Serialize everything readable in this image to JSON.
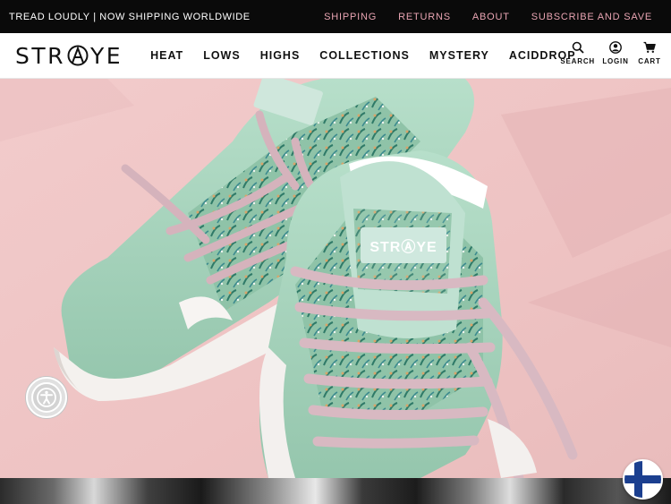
{
  "announcement": {
    "text": "TREAD LOUDLY | NOW SHIPPING WORLDWIDE",
    "links": [
      "SHIPPING",
      "RETURNS",
      "ABOUT",
      "SUBSCRIBE AND SAVE"
    ]
  },
  "header": {
    "logo": {
      "before": "STR",
      "after": "YE"
    },
    "nav": [
      "HEAT",
      "LOWS",
      "HIGHS",
      "COLLECTIONS",
      "MYSTERY",
      "ACIDDROP"
    ],
    "utility": {
      "search": {
        "label": "SEARCH",
        "icon": "search-icon"
      },
      "login": {
        "label": "LOGIN",
        "icon": "user-icon"
      },
      "cart": {
        "label": "CART",
        "icon": "cart-icon"
      }
    }
  },
  "hero": {
    "image": "mint-green-floral-sneakers-on-pink-background",
    "tongue_label": "STRⒶYE"
  },
  "widgets": {
    "accessibility": "accessibility-icon",
    "country_flag": "finland-flag-icon"
  },
  "colors": {
    "topbar_bg": "#0a0a0a",
    "topbar_link": "#e8a4b2",
    "hero_bg": "#f0c6c6",
    "sneaker_mint": "#a9d6bf",
    "laces": "#d8b8c0"
  }
}
